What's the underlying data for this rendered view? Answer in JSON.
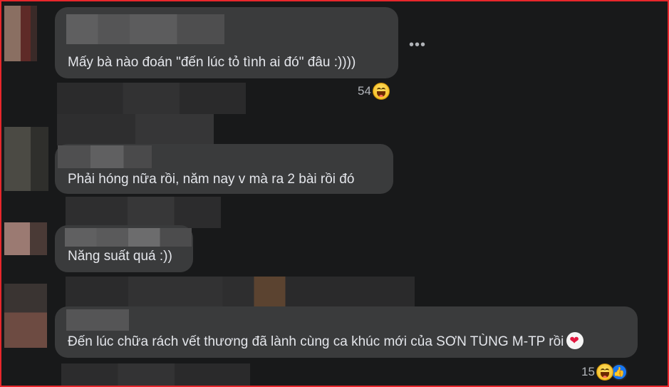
{
  "comments": [
    {
      "text": "Mấy bà nào đoán \"đến lúc tỏ tình ai đó\" đâu :))))",
      "reaction_count": "54"
    },
    {
      "text": "Phải hóng nữa rồi, năm nay v mà ra 2 bài rồi đó"
    },
    {
      "text": "Năng suất quá :))"
    },
    {
      "text": "Đến lúc chữa rách vết thương đã lành cùng ca khúc mới của SƠN TÙNG M-TP rồi",
      "reaction_count": "15"
    }
  ],
  "more_label": "•••",
  "icons": {
    "more": "more-options-icon",
    "haha": "haha-reaction-icon",
    "like": "like-reaction-icon",
    "heart": "heart-emoji-icon"
  },
  "colors": {
    "frame_border": "#e8262b",
    "background": "#18191a",
    "bubble": "#3a3b3c",
    "text": "#e4e6eb",
    "like": "#1877f2"
  }
}
